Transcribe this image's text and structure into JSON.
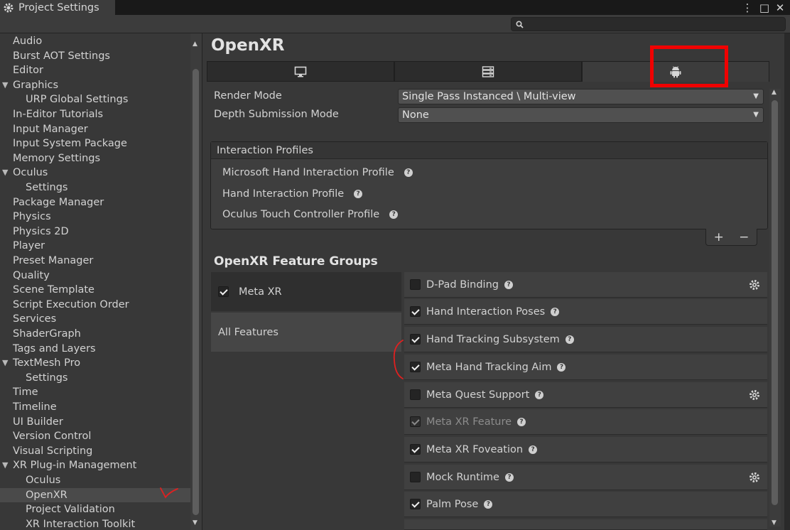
{
  "window": {
    "tab_title": "Project Settings",
    "controls": [
      "⋮",
      "□",
      "✕"
    ]
  },
  "search": {
    "placeholder": ""
  },
  "sidebar": {
    "items": [
      {
        "label": "Audio",
        "indent": 1
      },
      {
        "label": "Burst AOT Settings",
        "indent": 1
      },
      {
        "label": "Editor",
        "indent": 1
      },
      {
        "label": "Graphics",
        "indent": 1,
        "expanded": true
      },
      {
        "label": "URP Global Settings",
        "indent": 2
      },
      {
        "label": "In-Editor Tutorials",
        "indent": 1
      },
      {
        "label": "Input Manager",
        "indent": 1
      },
      {
        "label": "Input System Package",
        "indent": 1
      },
      {
        "label": "Memory Settings",
        "indent": 1
      },
      {
        "label": "Oculus",
        "indent": 1,
        "expanded": true
      },
      {
        "label": "Settings",
        "indent": 2
      },
      {
        "label": "Package Manager",
        "indent": 1
      },
      {
        "label": "Physics",
        "indent": 1
      },
      {
        "label": "Physics 2D",
        "indent": 1
      },
      {
        "label": "Player",
        "indent": 1
      },
      {
        "label": "Preset Manager",
        "indent": 1
      },
      {
        "label": "Quality",
        "indent": 1
      },
      {
        "label": "Scene Template",
        "indent": 1
      },
      {
        "label": "Script Execution Order",
        "indent": 1
      },
      {
        "label": "Services",
        "indent": 1
      },
      {
        "label": "ShaderGraph",
        "indent": 1
      },
      {
        "label": "Tags and Layers",
        "indent": 1
      },
      {
        "label": "TextMesh Pro",
        "indent": 1,
        "expanded": true
      },
      {
        "label": "Settings",
        "indent": 2
      },
      {
        "label": "Time",
        "indent": 1
      },
      {
        "label": "Timeline",
        "indent": 1
      },
      {
        "label": "UI Builder",
        "indent": 1
      },
      {
        "label": "Version Control",
        "indent": 1
      },
      {
        "label": "Visual Scripting",
        "indent": 1
      },
      {
        "label": "XR Plug-in Management",
        "indent": 1,
        "expanded": true
      },
      {
        "label": "Oculus",
        "indent": 2
      },
      {
        "label": "OpenXR",
        "indent": 2,
        "selected": true
      },
      {
        "label": "Project Validation",
        "indent": 2
      },
      {
        "label": "XR Interaction Toolkit",
        "indent": 2
      }
    ]
  },
  "main": {
    "title": "OpenXR",
    "platform_tabs": [
      {
        "icon": "desktop-icon",
        "active": false
      },
      {
        "icon": "server-icon",
        "active": false
      },
      {
        "icon": "android-icon",
        "active": true
      }
    ],
    "render_mode": {
      "label": "Render Mode",
      "value": "Single Pass Instanced \\ Multi-view"
    },
    "depth_mode": {
      "label": "Depth Submission Mode",
      "value": "None"
    },
    "interaction_profiles": {
      "header": "Interaction Profiles",
      "items": [
        "Microsoft Hand Interaction Profile",
        "Hand Interaction Profile",
        "Oculus Touch Controller Profile"
      ],
      "add_label": "+",
      "remove_label": "−"
    },
    "feature_groups": {
      "title": "OpenXR Feature Groups",
      "groups": [
        {
          "label": "Meta XR",
          "checked": true
        },
        {
          "label": "All Features"
        }
      ],
      "features": [
        {
          "label": "D-Pad Binding",
          "checked": false,
          "settings": true
        },
        {
          "label": "Hand Interaction Poses",
          "checked": true,
          "settings": false
        },
        {
          "label": "Hand Tracking Subsystem",
          "checked": true,
          "settings": false
        },
        {
          "label": "Meta Hand Tracking Aim",
          "checked": true,
          "settings": false
        },
        {
          "label": "Meta Quest Support",
          "checked": false,
          "settings": true
        },
        {
          "label": "Meta XR Feature",
          "checked": true,
          "disabled": true,
          "settings": false
        },
        {
          "label": "Meta XR Foveation",
          "checked": true,
          "settings": false
        },
        {
          "label": "Mock Runtime",
          "checked": false,
          "settings": true
        },
        {
          "label": "Palm Pose",
          "checked": true,
          "settings": false
        }
      ]
    }
  },
  "colors": {
    "highlight_box": "#f00101",
    "annotation_ink": "#e02020",
    "background": "#383838"
  }
}
